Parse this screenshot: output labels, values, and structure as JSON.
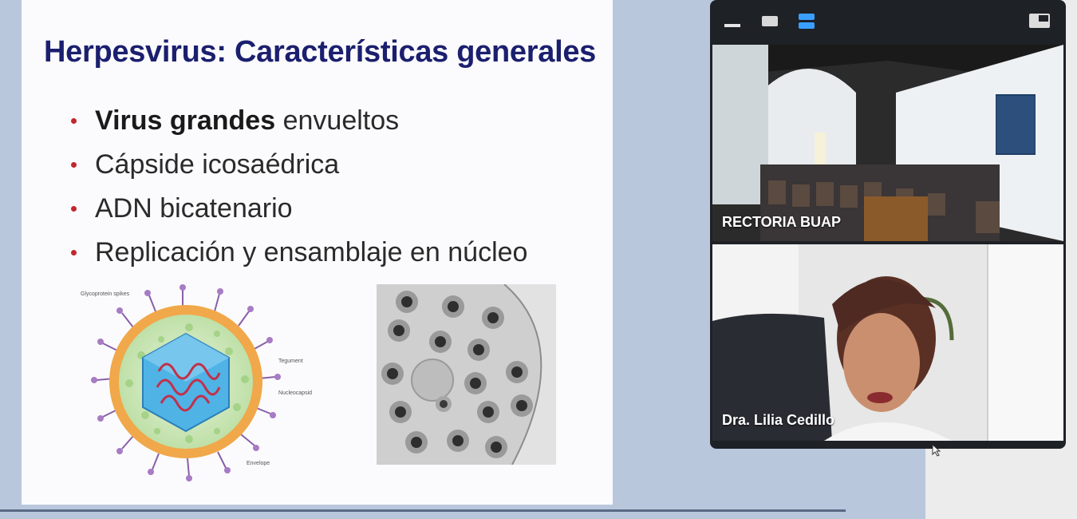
{
  "slide": {
    "title": "Herpesvirus: Características generales",
    "bullets": [
      {
        "bold": "Virus grandes",
        "rest": " envueltos"
      },
      {
        "bold": "",
        "rest": "Cápside icosaédrica"
      },
      {
        "bold": "",
        "rest": "ADN bicatenario"
      },
      {
        "bold": "",
        "rest": "Replicación y ensamblaje en núcleo"
      }
    ],
    "diagram_labels": {
      "glycoprotein": "Glycoprotein spikes",
      "tegument": "Tegument",
      "nucleocapsid": "Nucleocapsid",
      "envelope": "Envelope"
    },
    "colors": {
      "title": "#1b1f6e",
      "bullet_dot": "#c4262e"
    }
  },
  "video_panel": {
    "toolbar_icons": [
      "minimize-icon",
      "speaker-view-icon",
      "gallery-view-icon",
      "exit-fullscreen-icon"
    ],
    "participants": [
      {
        "name": "RECTORIA BUAP"
      },
      {
        "name": "Dra. Lilia Cedillo"
      }
    ]
  }
}
